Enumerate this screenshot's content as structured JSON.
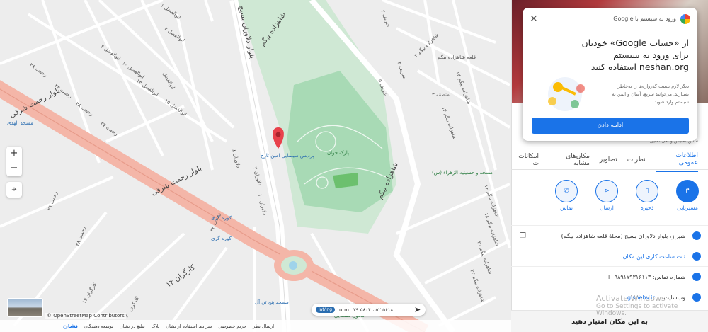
{
  "map": {
    "major_roads": [
      "بلوار رحمت شرقی",
      "بلوار دلاوران بسیج",
      "شاهزاده بیگم",
      "کارگران ۱۴"
    ],
    "street_labels": [
      "ابوالفضل ۱",
      "ابوالفضل ۴",
      "ابوالفضل ۷",
      "ابوالفضل ۱۰",
      "ابوالفضل ۱۳",
      "ابوالفضل ۱۵",
      "ابوالفضل",
      "رحمت ۴۸",
      "رحمت ۴۲",
      "رحمت ۳۸",
      "رحمت ۳۷",
      "رحمت ۲۹",
      "رحمت ۳۴",
      "رحمت ۲۸",
      "دلاوران ۳",
      "دلاوران ۸",
      "دلاوران ۱۰",
      "کارگران ۱۷",
      "کارگران ۲۰",
      "شریف ۲",
      "شریف ۴",
      "شریف ۵",
      "شاهزاده بیگم ۳",
      "شاهزاده بیگم ۱۲",
      "شاهزاده بیگم ۱۴",
      "شاهزاده بیگم ۱۶",
      "شاهزاده بیگم ۱۸",
      "شاهزاده بیگم ۲۰",
      "شاهزاده بیگم ۲۲",
      "منطقه ۳",
      "قلعه شاهزاده بیگم"
    ],
    "pois": {
      "main": "پردیس سینمایی امین تارخ",
      "park": "پارک جوان",
      "mosque_left": "مسجد الهدی",
      "mosque_right": "مسجد و حسینیه الزهراء (س)",
      "kooreh_gari_1": "کوره گری",
      "kooreh_gari_2": "کوره گری",
      "mosque_bottom": "مسجد پنج تن آل",
      "bottom_poi": "مادون قشقایی"
    },
    "zoom_in": "+",
    "zoom_out": "−",
    "osm_credit": "© OpenStreetMap Contributors",
    "coords": {
      "value": "۲۹.۵۸۰۴ ، ۵۲.۵۶۱۸",
      "mode_utm": "utm",
      "mode_latlng": "lat/lng"
    },
    "footer": [
      "ارسال نظر",
      "حریم خصوصی",
      "شرایط استفاده از نشان",
      "بلاگ",
      "تبلیغ در نشان",
      "توسعه دهندگان"
    ],
    "brand": "نشان"
  },
  "google_popup": {
    "header": "ورود به سیستم با Google",
    "title": "از «حساب Google» خودتان برای ورود به سیستم neshan.org استفاده کنید",
    "description": "دیگر لازم نیست گذرواژه‌ها را به‌خاطر بسپارید. می‌توانید سریع، آسان و ایمن به سیستم وارد شوید.",
    "continue_button": "ادامه دادن"
  },
  "panel": {
    "tabs": [
      "اطلاعات عمومی",
      "نظرات",
      "تصاویر",
      "مکان‌های مشابه",
      "امکانات ت"
    ],
    "subtitle": "سالن نمایش و اهل نمایی",
    "actions": [
      {
        "label": "مسیریابی",
        "icon": "directions-icon"
      },
      {
        "label": "ذخیره",
        "icon": "bookmark-icon"
      },
      {
        "label": "ارسال",
        "icon": "share-icon"
      },
      {
        "label": "تماس",
        "icon": "phone-icon"
      }
    ],
    "address": "شیراز، بلوار دلاوران بسیج (محلهٔ قلعه شاهزاده بیگم)",
    "hours_link": "ثبت ساعت کاری این مکان",
    "phone": "شماره تماس: ۰۹۸۹۱۷۹۳۱۶۱۱۳+",
    "website_label": "وب‌سایت:",
    "website": "gishehv.ir",
    "rate": "به این مکان امتیاز دهید"
  },
  "watermark": {
    "line1": "Activate Windows",
    "line2": "Go to Settings to activate Windows."
  },
  "colors": {
    "accent": "#1a73e8",
    "park": "#a8dab5",
    "road": "#f4b6a8"
  }
}
